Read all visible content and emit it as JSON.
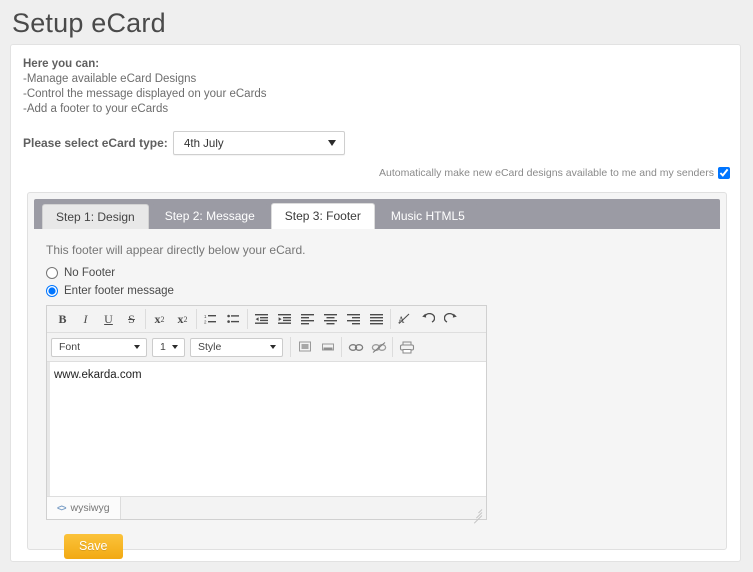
{
  "page": {
    "title": "Setup eCard"
  },
  "intro": {
    "heading": "Here you can:",
    "lines": [
      "-Manage available eCard Designs",
      "-Control the message displayed on your eCards",
      "-Add a footer to your eCards"
    ]
  },
  "ecard_type": {
    "label": "Please select eCard type:",
    "selected": "4th July",
    "options": [
      "4th July"
    ]
  },
  "auto_available": {
    "label": "Automatically make new eCard designs available to me and my senders",
    "checked": true
  },
  "tabs": [
    {
      "label": "Step 1: Design",
      "state": "light"
    },
    {
      "label": "Step 2: Message",
      "state": "dark"
    },
    {
      "label": "Step 3: Footer",
      "state": "active"
    },
    {
      "label": "Music HTML5",
      "state": "dark"
    }
  ],
  "footer_panel": {
    "hint": "This footer will appear directly below your eCard.",
    "radios": [
      {
        "label": "No Footer",
        "selected": false
      },
      {
        "label": "Enter footer message",
        "selected": true
      }
    ]
  },
  "editor": {
    "content": "www.ekarda.com",
    "toolbar_row1": [
      {
        "name": "bold-icon",
        "glyph": "B"
      },
      {
        "name": "italic-icon",
        "glyph": "I"
      },
      {
        "name": "underline-icon",
        "glyph": "U"
      },
      {
        "name": "strikethrough-icon",
        "glyph": "S"
      },
      {
        "name": "subscript-icon",
        "glyph": "x"
      },
      {
        "name": "superscript-icon",
        "glyph": "x"
      },
      {
        "name": "ordered-list-icon",
        "glyph": ""
      },
      {
        "name": "unordered-list-icon",
        "glyph": ""
      },
      {
        "name": "outdent-icon",
        "glyph": ""
      },
      {
        "name": "indent-icon",
        "glyph": ""
      },
      {
        "name": "align-left-icon",
        "glyph": ""
      },
      {
        "name": "align-center-icon",
        "glyph": ""
      },
      {
        "name": "align-right-icon",
        "glyph": ""
      },
      {
        "name": "align-justify-icon",
        "glyph": ""
      },
      {
        "name": "remove-format-icon",
        "glyph": ""
      },
      {
        "name": "undo-icon",
        "glyph": ""
      },
      {
        "name": "redo-icon",
        "glyph": ""
      }
    ],
    "font_select": {
      "label": "Font",
      "options": [
        "Font"
      ]
    },
    "size_select": {
      "label": "1",
      "options": [
        "1"
      ]
    },
    "style_select": {
      "label": "Style",
      "options": [
        "Style"
      ]
    },
    "toolbar_row2_icons": [
      {
        "name": "text-color-icon"
      },
      {
        "name": "background-color-icon"
      },
      {
        "name": "insert-link-icon"
      },
      {
        "name": "unlink-icon"
      },
      {
        "name": "print-icon"
      }
    ],
    "status": {
      "mode_label": "wysiwyg",
      "mode_icon": "code-icon"
    }
  },
  "save": {
    "label": "Save",
    "color": "#f7b51e"
  }
}
